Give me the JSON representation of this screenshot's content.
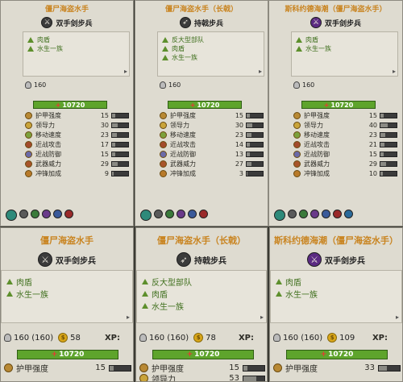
{
  "top_cards": [
    {
      "title": "僵尸海盗水手",
      "unit_type": "双手剑步兵",
      "icon": "crossed-swords-icon",
      "attributes": [
        "肉盾",
        "水生一族"
      ],
      "unit_size": "160",
      "health": "10720",
      "stats": [
        {
          "label": "护甲强度",
          "value": "15",
          "level": 0.18
        },
        {
          "label": "领导力",
          "value": "30",
          "level": 0.35
        },
        {
          "label": "移动速度",
          "value": "23",
          "level": 0.3
        },
        {
          "label": "近战攻击",
          "value": "17",
          "level": 0.22
        },
        {
          "label": "近战防御",
          "value": "15",
          "level": 0.2
        },
        {
          "label": "武器威力",
          "value": "29",
          "level": 0.35
        },
        {
          "label": "冲锋加成",
          "value": "9",
          "level": 0.12
        }
      ]
    },
    {
      "title": "僵尸海盗水手（长戟）",
      "unit_type": "持戟步兵",
      "icon": "halberd-icon",
      "attributes": [
        "反大型部队",
        "肉盾",
        "水生一族"
      ],
      "unit_size": "160",
      "health": "10720",
      "stats": [
        {
          "label": "护甲强度",
          "value": "15",
          "level": 0.18
        },
        {
          "label": "领导力",
          "value": "30",
          "level": 0.35
        },
        {
          "label": "移动速度",
          "value": "23",
          "level": 0.3
        },
        {
          "label": "近战攻击",
          "value": "14",
          "level": 0.2
        },
        {
          "label": "近战防御",
          "value": "13",
          "level": 0.18
        },
        {
          "label": "武器威力",
          "value": "27",
          "level": 0.32
        },
        {
          "label": "冲锋加成",
          "value": "3",
          "level": 0.05
        }
      ]
    },
    {
      "title": "斯科约德海潮（僵尸海盗水手）",
      "unit_type": "双手剑步兵",
      "icon": "crossed-swords-icon",
      "attributes": [
        "肉盾",
        "水生一族"
      ],
      "unit_size": "160",
      "health": "10720",
      "stats": [
        {
          "label": "护甲强度",
          "value": "15",
          "level": 0.18
        },
        {
          "label": "领导力",
          "value": "40",
          "level": 0.45
        },
        {
          "label": "移动速度",
          "value": "23",
          "level": 0.3
        },
        {
          "label": "近战攻击",
          "value": "21",
          "level": 0.26
        },
        {
          "label": "近战防御",
          "value": "15",
          "level": 0.2
        },
        {
          "label": "武器威力",
          "value": "29",
          "level": 0.35
        },
        {
          "label": "冲锋加成",
          "value": "10",
          "level": 0.13
        }
      ]
    }
  ],
  "bottom_cards": [
    {
      "title": "僵尸海盗水手",
      "unit_type": "双手剑步兵",
      "attributes": [
        "肉盾",
        "水生一族"
      ],
      "unit_size": "160 (160)",
      "cost": "58",
      "xp_label": "XP:",
      "health": "10720",
      "stats": [
        {
          "label": "护甲强度",
          "value": "15",
          "level": 0.18
        }
      ]
    },
    {
      "title": "僵尸海盗水手（长戟）",
      "unit_type": "持戟步兵",
      "attributes": [
        "反大型部队",
        "肉盾",
        "水生一族"
      ],
      "unit_size": "160 (160)",
      "cost": "78",
      "xp_label": "XP:",
      "health": "10720",
      "stats": [
        {
          "label": "护甲强度",
          "value": "15",
          "level": 0.18
        },
        {
          "label": "领导力",
          "value": "53",
          "level": 0.6
        }
      ]
    },
    {
      "title": "斯科约德海潮（僵尸海盗水手）",
      "unit_type": "双手剑步兵",
      "attributes": [
        "肉盾",
        "水生一族"
      ],
      "unit_size": "160 (160)",
      "cost": "109",
      "xp_label": "XP:",
      "health": "10720",
      "stats": [
        {
          "label": "护甲强度",
          "value": "33",
          "level": 0.4
        }
      ]
    }
  ]
}
